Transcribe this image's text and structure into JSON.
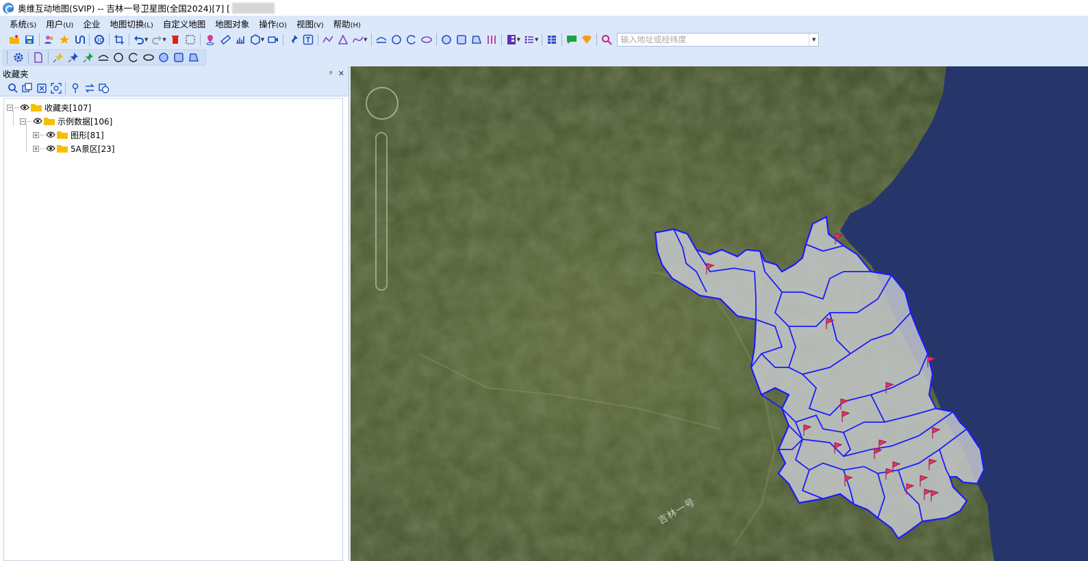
{
  "window": {
    "title": "奥维互动地图(SVIP) -- 吉林一号卫星图(全国2024)[7] ["
  },
  "menu": [
    {
      "label": "系统",
      "acc": "(S)"
    },
    {
      "label": "用户",
      "acc": "(U)"
    },
    {
      "label": "企业",
      "acc": ""
    },
    {
      "label": "地图切换",
      "acc": "(L)"
    },
    {
      "label": "自定义地图",
      "acc": ""
    },
    {
      "label": "地图对象",
      "acc": ""
    },
    {
      "label": "操作",
      "acc": "(O)"
    },
    {
      "label": "视图",
      "acc": "(V)"
    },
    {
      "label": "帮助",
      "acc": "(H)"
    }
  ],
  "search": {
    "placeholder": "输入地址或经纬度",
    "value": ""
  },
  "panel": {
    "title": "收藏夹",
    "pin_glyph": "ᵖ",
    "close_glyph": "✕"
  },
  "tree": [
    {
      "label": "收藏夹[107]",
      "expander": "⊟"
    },
    {
      "label": "示例数据[106]",
      "expander": "⊟"
    },
    {
      "label": "图形[81]",
      "expander": "⊞"
    },
    {
      "label": "5A景区[23]",
      "expander": "⊞"
    }
  ],
  "map": {
    "watermark": "吉林一号",
    "accent": "#1a1aff",
    "flag_color": "#e8336b",
    "sea_color": "#27366a"
  }
}
